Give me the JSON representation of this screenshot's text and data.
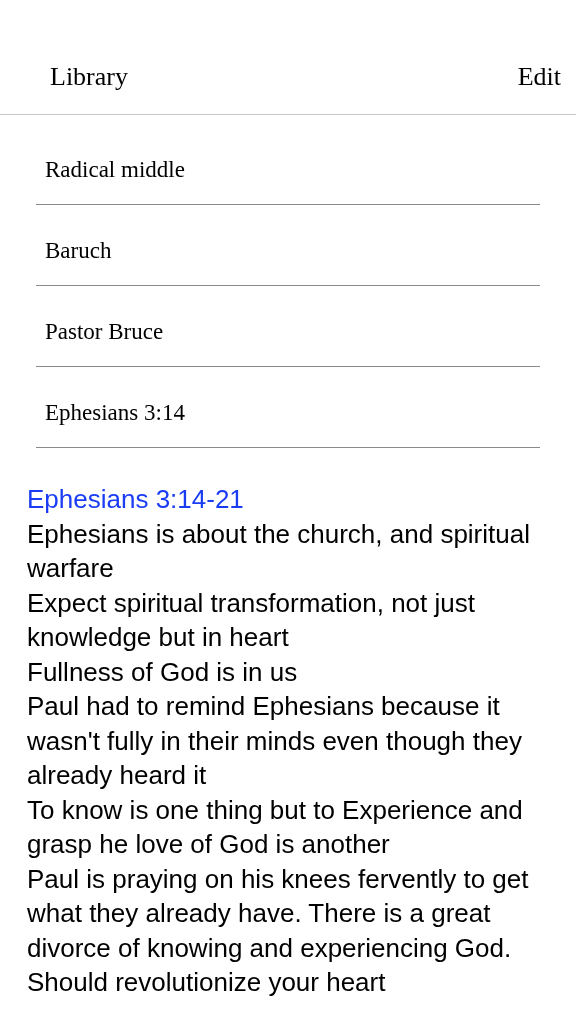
{
  "nav": {
    "back": "Library",
    "action": "Edit"
  },
  "notes": [
    {
      "title": "Radical middle"
    },
    {
      "title": "Baruch"
    },
    {
      "title": "Pastor Bruce"
    },
    {
      "title": "Ephesians 3:14"
    }
  ],
  "detail": {
    "link": "Ephesians 3:14-21",
    "paragraphs": [
      "Ephesians is about the church, and spiritual warfare",
      "Expect spiritual transformation, not just knowledge but in heart",
      "Fullness of God is in us",
      "Paul had to remind Ephesians because it wasn't fully in their minds even though they already heard it",
      "To know is one thing but to Experience and grasp he love of God is another",
      "Paul is praying on his knees fervently to get what they already have. There is a great divorce of knowing and experiencing God. Should revolutionize your heart"
    ]
  }
}
